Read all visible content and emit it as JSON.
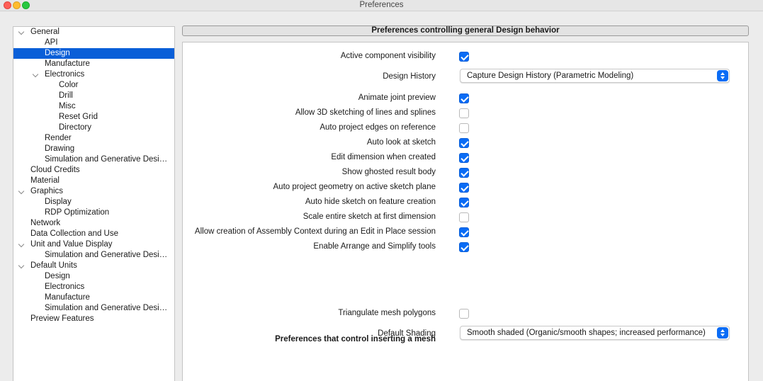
{
  "window": {
    "title": "Preferences"
  },
  "tree": [
    {
      "label": "General",
      "level": 0,
      "expanded": true
    },
    {
      "label": "API",
      "level": 1
    },
    {
      "label": "Design",
      "level": 1,
      "selected": true
    },
    {
      "label": "Manufacture",
      "level": 1
    },
    {
      "label": "Electronics",
      "level": 1,
      "expanded": true
    },
    {
      "label": "Color",
      "level": 2
    },
    {
      "label": "Drill",
      "level": 2
    },
    {
      "label": "Misc",
      "level": 2
    },
    {
      "label": "Reset Grid",
      "level": 2
    },
    {
      "label": "Directory",
      "level": 2
    },
    {
      "label": "Render",
      "level": 1
    },
    {
      "label": "Drawing",
      "level": 1
    },
    {
      "label": "Simulation and Generative Desi…",
      "level": 1
    },
    {
      "label": "Cloud Credits",
      "level": 0
    },
    {
      "label": "Material",
      "level": 0
    },
    {
      "label": "Graphics",
      "level": 0,
      "expanded": true
    },
    {
      "label": "Display",
      "level": 1
    },
    {
      "label": "RDP Optimization",
      "level": 1
    },
    {
      "label": "Network",
      "level": 0
    },
    {
      "label": "Data Collection and Use",
      "level": 0
    },
    {
      "label": "Unit and Value Display",
      "level": 0,
      "expanded": true
    },
    {
      "label": "Simulation and Generative Desi…",
      "level": 1
    },
    {
      "label": "Default Units",
      "level": 0,
      "expanded": true
    },
    {
      "label": "Design",
      "level": 1
    },
    {
      "label": "Electronics",
      "level": 1
    },
    {
      "label": "Manufacture",
      "level": 1
    },
    {
      "label": "Simulation and Generative Desi…",
      "level": 1
    },
    {
      "label": "Preview Features",
      "level": 0
    }
  ],
  "panel": {
    "header": "Preferences controlling general Design behavior",
    "active_component_visibility": {
      "label": "Active component visibility",
      "checked": true
    },
    "design_history": {
      "label": "Design History",
      "value": "Capture Design History (Parametric Modeling)"
    },
    "options": [
      {
        "label": "Animate joint preview",
        "checked": true
      },
      {
        "label": "Allow 3D sketching of lines and splines",
        "checked": false
      },
      {
        "label": "Auto project edges on reference",
        "checked": false
      },
      {
        "label": "Auto look at sketch",
        "checked": true
      },
      {
        "label": "Edit dimension when created",
        "checked": true
      },
      {
        "label": "Show ghosted result body",
        "checked": true
      },
      {
        "label": "Auto project geometry on active sketch plane",
        "checked": true
      },
      {
        "label": "Auto hide sketch on feature creation",
        "checked": true
      },
      {
        "label": "Scale entire sketch at first dimension",
        "checked": false
      },
      {
        "label": "Allow creation of Assembly Context during an Edit in Place session",
        "checked": true
      },
      {
        "label": "Enable Arrange and Simplify tools",
        "checked": true
      }
    ],
    "mesh_section": {
      "title": "Preferences that control inserting a mesh",
      "triangulate": {
        "label": "Triangulate mesh polygons",
        "checked": false
      },
      "default_shading": {
        "label": "Default Shading",
        "value": "Smooth shaded (Organic/smooth shapes; increased performance)"
      }
    }
  },
  "colors": {
    "accent": "#0a6cf5",
    "selection": "#0a5fd8"
  }
}
